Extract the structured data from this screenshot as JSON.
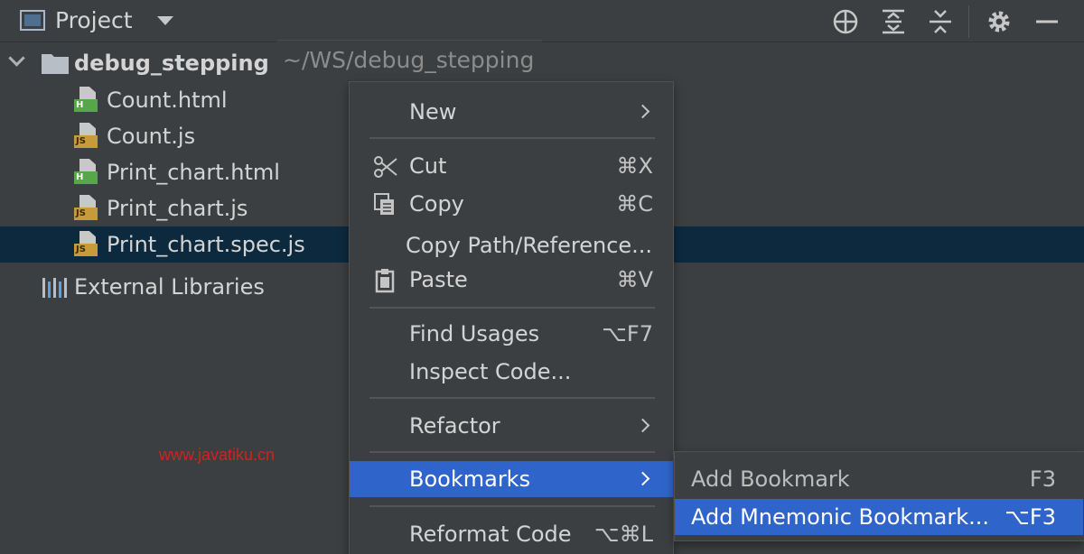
{
  "header": {
    "title": "Project",
    "icons": [
      "locate-icon",
      "expand-all-icon",
      "collapse-all-icon",
      "gear-icon",
      "minimize-icon"
    ]
  },
  "tree": {
    "root_label": "debug_stepping",
    "root_path": "~/WS/debug_stepping",
    "files": [
      {
        "label": "Count.html",
        "type": "H"
      },
      {
        "label": "Count.js",
        "type": "JS"
      },
      {
        "label": "Print_chart.html",
        "type": "H"
      },
      {
        "label": "Print_chart.js",
        "type": "JS"
      },
      {
        "label": "Print_chart.spec.js",
        "type": "JS"
      }
    ],
    "external_libraries": "External Libraries"
  },
  "watermark": "www.javatiku.cn",
  "context_menu": {
    "items": [
      {
        "label": "New",
        "shortcut": ""
      },
      {
        "label": "Cut",
        "shortcut": "⌘X"
      },
      {
        "label": "Copy",
        "shortcut": "⌘C"
      },
      {
        "label": "Copy Path/Reference...",
        "shortcut": ""
      },
      {
        "label": "Paste",
        "shortcut": "⌘V"
      },
      {
        "label": "Find Usages",
        "shortcut": "⌥F7"
      },
      {
        "label": "Inspect Code...",
        "shortcut": ""
      },
      {
        "label": "Refactor",
        "shortcut": ""
      },
      {
        "label": "Bookmarks",
        "shortcut": ""
      },
      {
        "label": "Reformat Code",
        "shortcut": "⌥⌘L"
      }
    ]
  },
  "bookmarks_submenu": {
    "items": [
      {
        "label": "Add Bookmark",
        "shortcut": "F3"
      },
      {
        "label": "Add Mnemonic Bookmark...",
        "shortcut": "⌥F3"
      }
    ]
  },
  "colors": {
    "background": "#3c3f41",
    "selection": "#0d293e",
    "menu_active": "#2f65ca",
    "watermark": "#c8261f"
  }
}
